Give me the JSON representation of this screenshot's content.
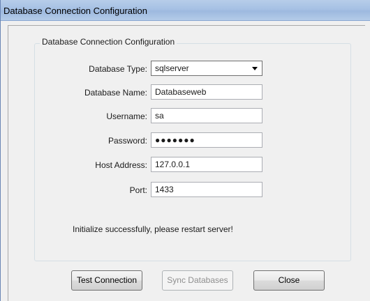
{
  "window": {
    "title": "Database Connection Configuration"
  },
  "group": {
    "title": "Database Connection Configuration"
  },
  "form": {
    "database_type": {
      "label": "Database Type:",
      "value": "sqlserver"
    },
    "database_name": {
      "label": "Database Name:",
      "value": "Databaseweb"
    },
    "username": {
      "label": "Username:",
      "value": "sa"
    },
    "password": {
      "label": "Password:",
      "value": "●●●●●●●"
    },
    "host_address": {
      "label": "Host Address:",
      "value": "127.0.0.1"
    },
    "port": {
      "label": "Port:",
      "value": "1433"
    }
  },
  "status": {
    "message": "Initialize successfully, please restart server!"
  },
  "buttons": {
    "test_connection": "Test Connection",
    "sync_databases": "Sync Databases",
    "close": "Close"
  }
}
